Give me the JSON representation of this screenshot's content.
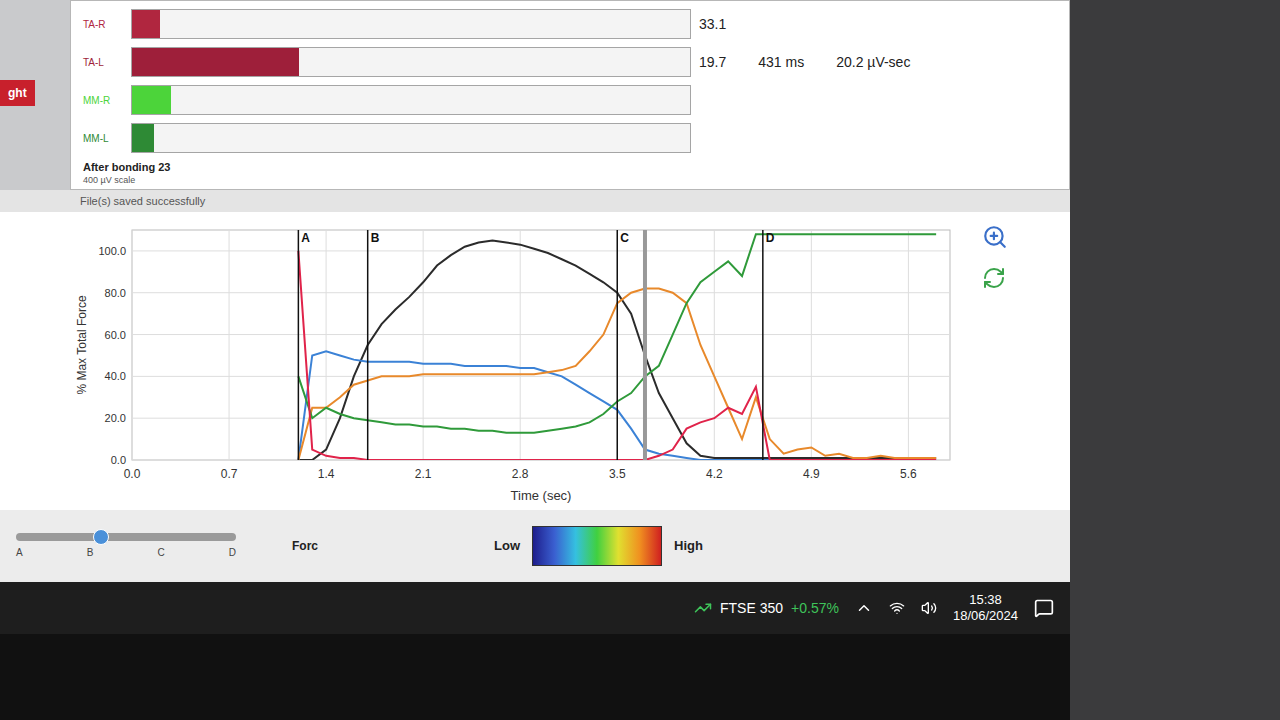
{
  "status_tag": "ght",
  "emg": {
    "title": "After bonding 23",
    "scale": "400 µV scale",
    "rows": [
      {
        "label": "TA-R",
        "level": 0.05,
        "color": "#b0263f",
        "readings": [
          "33.1"
        ]
      },
      {
        "label": "TA-L",
        "level": 0.3,
        "color": "#9e1f3a",
        "readings": [
          "19.7",
          "431 ms",
          "20.2 µV-sec"
        ]
      },
      {
        "label": "MM-R",
        "level": 0.07,
        "color": "#4cd43a",
        "readings": []
      },
      {
        "label": "MM-L",
        "level": 0.04,
        "color": "#2e8a35",
        "readings": []
      }
    ]
  },
  "status_message": "File(s) saved successfully",
  "chart": {
    "y_label": "% Max Total Force",
    "x_label": "Time (sec)",
    "y_ticks": [
      "0.0",
      "20.0",
      "40.0",
      "60.0",
      "80.0",
      "100.0"
    ],
    "x_ticks": [
      "0.0",
      "0.7",
      "1.4",
      "2.1",
      "2.8",
      "3.5",
      "4.2",
      "4.9",
      "5.6"
    ],
    "y_max": 110,
    "x_max": 5.9,
    "x_start": 1.2,
    "x_step": 0.1,
    "markers": [
      {
        "label": "A",
        "x": 1.2
      },
      {
        "label": "B",
        "x": 1.7
      },
      {
        "label": "C",
        "x": 3.5
      },
      {
        "label": "D",
        "x": 4.55
      }
    ],
    "cursor": 3.7,
    "series": [
      {
        "name": "total force",
        "color": "#2b2b2b",
        "values": [
          0,
          0,
          5,
          20,
          40,
          55,
          65,
          72,
          78,
          85,
          93,
          98,
          102,
          104,
          105,
          104,
          103,
          101,
          99,
          96,
          93,
          89,
          85,
          80,
          70,
          50,
          32,
          20,
          8,
          2,
          1,
          1,
          1,
          1,
          1,
          1,
          1,
          1,
          1,
          1,
          1,
          1,
          1,
          1,
          1,
          1,
          1
        ]
      },
      {
        "name": "blue",
        "color": "#3b82d6",
        "values": [
          0,
          50,
          52,
          50,
          48,
          47,
          47,
          47,
          47,
          46,
          46,
          46,
          45,
          45,
          45,
          45,
          44,
          44,
          42,
          40,
          36,
          32,
          28,
          24,
          15,
          5,
          3,
          2,
          1,
          0,
          0,
          0,
          0,
          0,
          0,
          0,
          0,
          0,
          0,
          0,
          0,
          0,
          0,
          0,
          0,
          0,
          0
        ]
      },
      {
        "name": "orange",
        "color": "#e8892b",
        "values": [
          0,
          25,
          25,
          30,
          36,
          38,
          40,
          40,
          40,
          41,
          41,
          41,
          41,
          41,
          41,
          41,
          41,
          41,
          42,
          43,
          45,
          52,
          60,
          75,
          80,
          82,
          82,
          80,
          75,
          55,
          40,
          25,
          10,
          30,
          10,
          3,
          5,
          6,
          2,
          3,
          1,
          1,
          2,
          1,
          1,
          1,
          1
        ]
      },
      {
        "name": "green",
        "color": "#2f9a3a",
        "values": [
          40,
          20,
          25,
          22,
          20,
          19,
          18,
          17,
          17,
          16,
          16,
          15,
          15,
          14,
          14,
          13,
          13,
          13,
          14,
          15,
          16,
          18,
          22,
          28,
          32,
          40,
          45,
          60,
          75,
          85,
          90,
          95,
          88,
          108,
          108,
          108,
          108,
          108,
          108,
          108,
          108,
          108,
          108,
          108,
          108,
          108,
          108
        ]
      },
      {
        "name": "red",
        "color": "#e0234a",
        "values": [
          100,
          5,
          2,
          1,
          1,
          0,
          0,
          0,
          0,
          0,
          0,
          0,
          0,
          0,
          0,
          0,
          0,
          0,
          0,
          0,
          0,
          0,
          0,
          0,
          0,
          0,
          2,
          5,
          15,
          18,
          20,
          25,
          22,
          35,
          0,
          0,
          0,
          0,
          0,
          0,
          0,
          0,
          0,
          0,
          0,
          0,
          0
        ]
      }
    ]
  },
  "controls": {
    "slider": {
      "labels": [
        "A",
        "B",
        "C",
        "D"
      ],
      "level": 0.35
    },
    "force_label": "Forc",
    "scale": {
      "low": "Low",
      "high": "High"
    }
  },
  "taskbar": {
    "ticker": "FTSE 350",
    "change": "+0.57%",
    "time": "15:38",
    "date": "18/06/2024"
  }
}
